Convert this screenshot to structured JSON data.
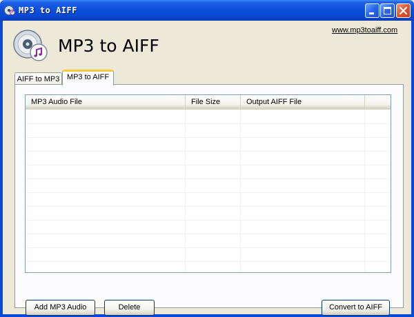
{
  "window": {
    "title": "MP3 to AIFF",
    "colors": {
      "titlebar": "#0a4ed9",
      "face": "#ece9d8",
      "tab_highlight": "#ffc83c"
    }
  },
  "header": {
    "app_title": "MP3 to AIFF",
    "website_link": "www.mp3toaiff.com",
    "logo_icon": "disc-music-icon"
  },
  "tabs": [
    {
      "label": "AIFF to MP3",
      "active": false
    },
    {
      "label": "MP3 to AIFF",
      "active": true
    }
  ],
  "file_list": {
    "columns": [
      "MP3 Audio File",
      "File Size",
      "Output AIFF File",
      ""
    ],
    "rows": []
  },
  "buttons": {
    "add": "Add MP3 Audio",
    "delete": "Delete",
    "convert": "Convert to AIFF"
  }
}
